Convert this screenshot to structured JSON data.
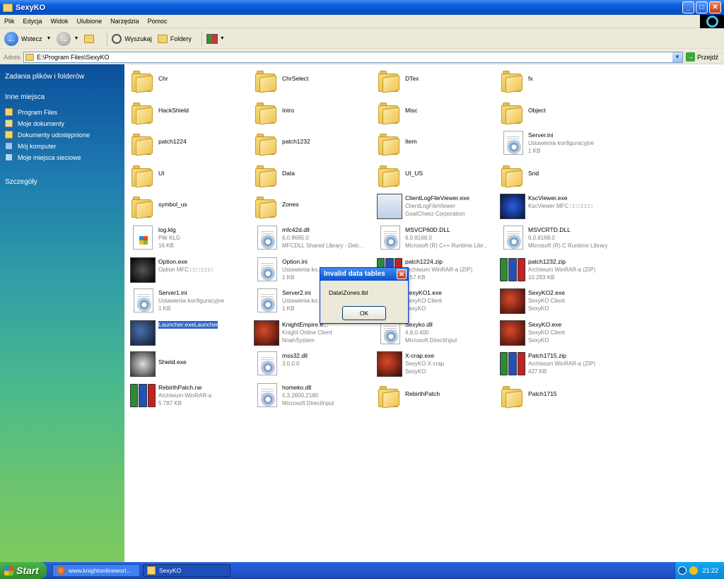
{
  "window": {
    "title": "SexyKO",
    "controls": {
      "minimize": "_",
      "maximize": "□",
      "close": "✕"
    }
  },
  "menu": [
    "Plik",
    "Edycja",
    "Widok",
    "Ulubione",
    "Narzędzia",
    "Pomoc"
  ],
  "toolbar": {
    "back_label": "Wstecz",
    "search_label": "Wyszukaj",
    "folders_label": "Foldery"
  },
  "address": {
    "label": "Adres",
    "value": "E:\\Program Files\\SexyKO",
    "go_label": "Przejdź"
  },
  "sidebar": {
    "tasks_heading": "Zadania plików i folderów",
    "other_heading": "Inne miejsca",
    "details_heading": "Szczegóły",
    "places": [
      {
        "label": "Program Files",
        "icon": "folder-icon"
      },
      {
        "label": "Moje dokumenty",
        "icon": "documents-icon"
      },
      {
        "label": "Dokumenty udostępnione",
        "icon": "shared-folder-icon"
      },
      {
        "label": "Mój komputer",
        "icon": "computer-icon"
      },
      {
        "label": "Moje miejsca sieciowe",
        "icon": "network-icon"
      }
    ]
  },
  "files": [
    {
      "name": "Chr",
      "type": "folder"
    },
    {
      "name": "ChrSelect",
      "type": "folder"
    },
    {
      "name": "DTex",
      "type": "folder"
    },
    {
      "name": "fx",
      "type": "folder"
    },
    {
      "name": "HackShield",
      "type": "folder"
    },
    {
      "name": "Intro",
      "type": "folder"
    },
    {
      "name": "Misc",
      "type": "folder"
    },
    {
      "name": "Object",
      "type": "folder"
    },
    {
      "name": "patch1224",
      "type": "folder"
    },
    {
      "name": "patch1232",
      "type": "folder"
    },
    {
      "name": "Item",
      "type": "folder"
    },
    {
      "name": "Server.ini",
      "type": "ini",
      "line2": "Ustawienia konfiguracyjne",
      "line3": "1 KB"
    },
    {
      "name": "UI",
      "type": "folder"
    },
    {
      "name": "Data",
      "type": "folder"
    },
    {
      "name": "UI_US",
      "type": "folder"
    },
    {
      "name": "Snd",
      "type": "folder"
    },
    {
      "name": "symbol_us",
      "type": "folder"
    },
    {
      "name": "Zones",
      "type": "folder"
    },
    {
      "name": "ClientLogFileViewer.exe",
      "type": "app-window",
      "line2": "ClientLogFileViewer",
      "line3": "GoatCheez Corporation"
    },
    {
      "name": "KscViewer.exe",
      "type": "app-s",
      "line2": "KscViewer MFC □□ □□□□",
      "line3": ""
    },
    {
      "name": "log.klg",
      "type": "winfile",
      "line2": "Plik KLG",
      "line3": "16 KB"
    },
    {
      "name": "mfc42d.dll",
      "type": "dll",
      "line2": "6.0.8665.0",
      "line3": "MFCDLL Shared Library - Deb..."
    },
    {
      "name": "MSVCP60D.DLL",
      "type": "dll",
      "line2": "6.0.8168.0",
      "line3": "Microsoft (R) C++ Runtime Libr..."
    },
    {
      "name": "MSVCRTD.DLL",
      "type": "dll",
      "line2": "6.0.8168.0",
      "line3": "Microsoft (R) C Runtime Library"
    },
    {
      "name": "Option.exe",
      "type": "app-dark",
      "line2": "Option MFC □□ □□□□",
      "line3": ""
    },
    {
      "name": "Option.ini",
      "type": "ini",
      "line2": "Ustawienia ko...",
      "line3": "1 KB"
    },
    {
      "name": "patch1224.zip",
      "type": "rar",
      "line2": "Archiwum WinRAR-a (ZIP)",
      "line3": "...57 KB"
    },
    {
      "name": "patch1232.zip",
      "type": "rar",
      "line2": "Archiwum WinRAR-a (ZIP)",
      "line3": "10 283 KB"
    },
    {
      "name": "Server1.ini",
      "type": "ini",
      "line2": "Ustawienia konfiguracyjne",
      "line3": "1 KB"
    },
    {
      "name": "Server2.ini",
      "type": "ini",
      "line2": "Ustawienia ko...",
      "line3": "1 KB"
    },
    {
      "name": "SexyKO1.exe",
      "type": "app-red",
      "line2": "SexyKO Client",
      "line3": "SexyKO"
    },
    {
      "name": "SexyKO2.exe",
      "type": "app-red",
      "line2": "SexyKO Client",
      "line3": "SexyKO"
    },
    {
      "name": "Launcher.exe",
      "type": "app-blue",
      "line2": "Launcher",
      "line3": "",
      "selected": true
    },
    {
      "name": "KnightEmpire.e...",
      "type": "app-red",
      "line2": "Knight Online Client",
      "line3": "NoahSystem"
    },
    {
      "name": "Sexyko.dll",
      "type": "dll",
      "line2": "4.8.0.400",
      "line3": "Microsoft DirectInput"
    },
    {
      "name": "SexyKO.exe",
      "type": "app-red",
      "line2": "SexyKO Client",
      "line3": "SexyKO"
    },
    {
      "name": "Shield.exe",
      "type": "app-shield",
      "line2": "",
      "line3": ""
    },
    {
      "name": "mss32.dll",
      "type": "dll",
      "line2": "3.0.0.0",
      "line3": ""
    },
    {
      "name": "X-crap.exe",
      "type": "app-red",
      "line2": "SexyKO X-crap",
      "line3": "SexyKO"
    },
    {
      "name": "Patch1715.zip",
      "type": "rar",
      "line2": "Archiwum WinRAR-a (ZIP)",
      "line3": "427 KB"
    },
    {
      "name": "RebirthPatch.rar",
      "type": "rar",
      "line2": "Archiwum WinRAR-a",
      "line3": "5 787 KB"
    },
    {
      "name": "homeko.dll",
      "type": "dll",
      "line2": "5.3.2600.2180",
      "line3": "Microsoft DirectInput"
    },
    {
      "name": "RebirthPatch",
      "type": "folder"
    },
    {
      "name": "Patch1715",
      "type": "folder"
    }
  ],
  "dialog": {
    "title": "Invalid data tables",
    "message": "Data\\Zones.tbl",
    "ok_label": "OK",
    "close": "✕"
  },
  "taskbar": {
    "start_label": "Start",
    "tasks": [
      {
        "label": "www.knightonlineworl...",
        "icon": "firefox-icon"
      },
      {
        "label": "SexyKO",
        "icon": "folder-icon"
      }
    ],
    "clock": "21:22"
  },
  "colors": {
    "titlebar": "#0653d0",
    "selection": "#316ac5",
    "sidebar_top": "#0b4f9c",
    "sidebar_bottom": "#7ecb5d"
  }
}
